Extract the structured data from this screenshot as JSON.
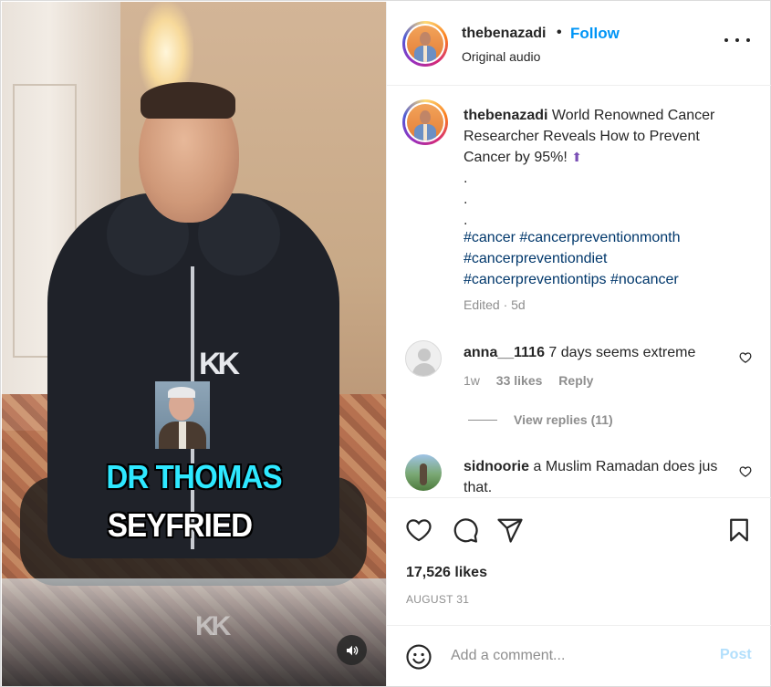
{
  "post": {
    "username": "thebenazadi",
    "separator": "•",
    "follow_label": "Follow",
    "audio_label": "Original audio",
    "caption_text": "World Renowned Cancer Researcher Reveals How to Prevent Cancer by 95%!",
    "caption_emoji": "⬆",
    "caption_dots": [
      ".",
      ".",
      "."
    ],
    "hashtags": [
      "#cancer",
      "#cancerpreventionmonth",
      "#cancerpreventiondiet",
      "#cancerpreventiontips",
      "#nocancer"
    ],
    "edited_label": "Edited · 5d",
    "likes": "17,526 likes",
    "date": "AUGUST 31"
  },
  "video": {
    "caption_line1": "DR THOMAS",
    "caption_line2": "SEYFRIED",
    "caption_line1_color": "#2ee8ff",
    "caption_line2_color": "#ffffff",
    "sound_icon": "speaker-icon"
  },
  "comments": [
    {
      "username": "anna__1116",
      "text": "7 days seems extreme",
      "time": "1w",
      "likes": "33 likes",
      "reply_label": "Reply",
      "view_replies": "View replies (11)"
    },
    {
      "username": "sidnoorie",
      "text": "a Muslim Ramadan does jus that."
    }
  ],
  "add_comment": {
    "placeholder": "Add a comment...",
    "post_label": "Post"
  },
  "colors": {
    "accent": "#0095f6",
    "text": "#262626",
    "muted": "#8e8e8e",
    "link": "#00376b",
    "post_disabled": "#b2dffc"
  },
  "icons": {
    "like": "heart-icon",
    "comment": "comment-icon",
    "share": "send-icon",
    "save": "bookmark-icon",
    "emoji": "emoji-icon",
    "more": "more-options-icon"
  }
}
